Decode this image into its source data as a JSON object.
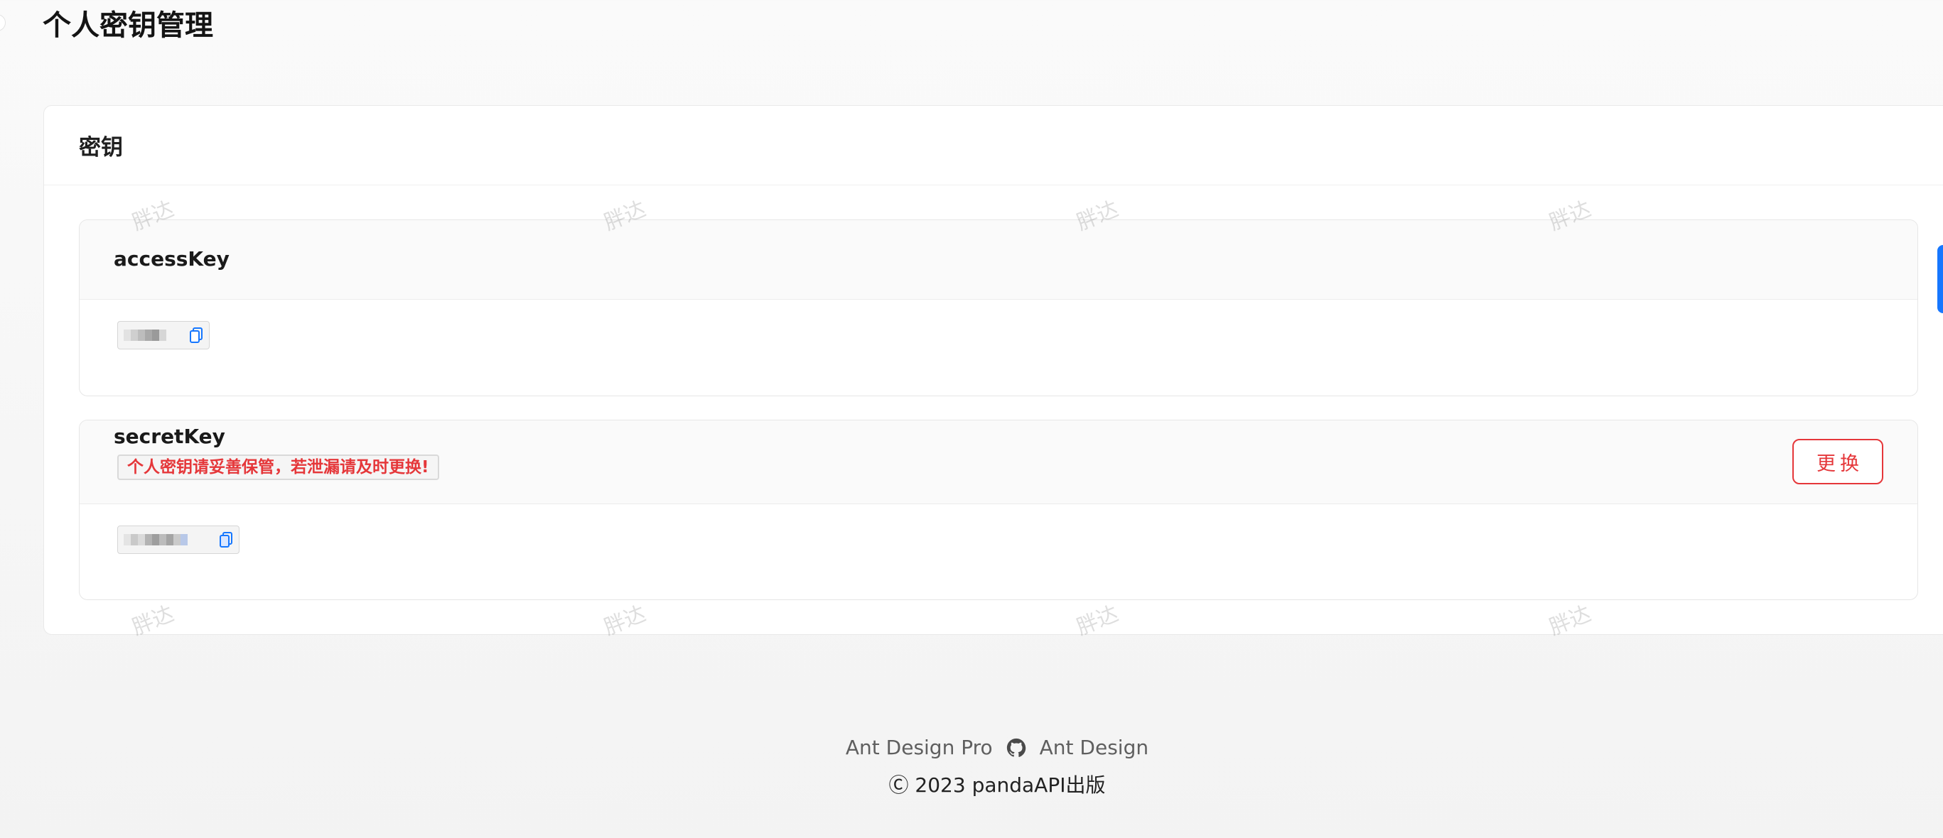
{
  "page": {
    "title": "个人密钥管理"
  },
  "card": {
    "title": "密钥"
  },
  "access_key": {
    "label": "accessKey"
  },
  "secret_key": {
    "label": "secretKey",
    "warning": "个人密钥请妥善保管，若泄漏请及时更换!",
    "change_button": "更换"
  },
  "watermark": {
    "text": "胖达"
  },
  "footer": {
    "link_pro": "Ant Design Pro",
    "link_ant": "Ant Design",
    "copyright": "Ⓒ 2023 pandaAPI出版"
  },
  "colors": {
    "danger": "#e5373a",
    "primary": "#1677ff"
  },
  "icons": {
    "copy": "copy-icon",
    "github": "github-icon"
  }
}
